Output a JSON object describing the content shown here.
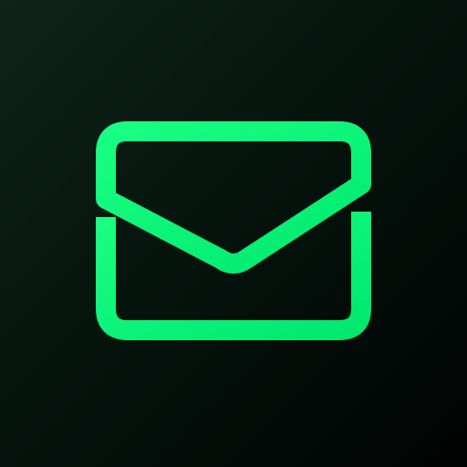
{
  "app_icon": {
    "icon": "mail-envelope-icon",
    "glyph_color": "#19ff84",
    "glyph_color_secondary": "#00e86e",
    "background_colors": [
      "#0d2419",
      "#06140e",
      "#010302"
    ]
  }
}
